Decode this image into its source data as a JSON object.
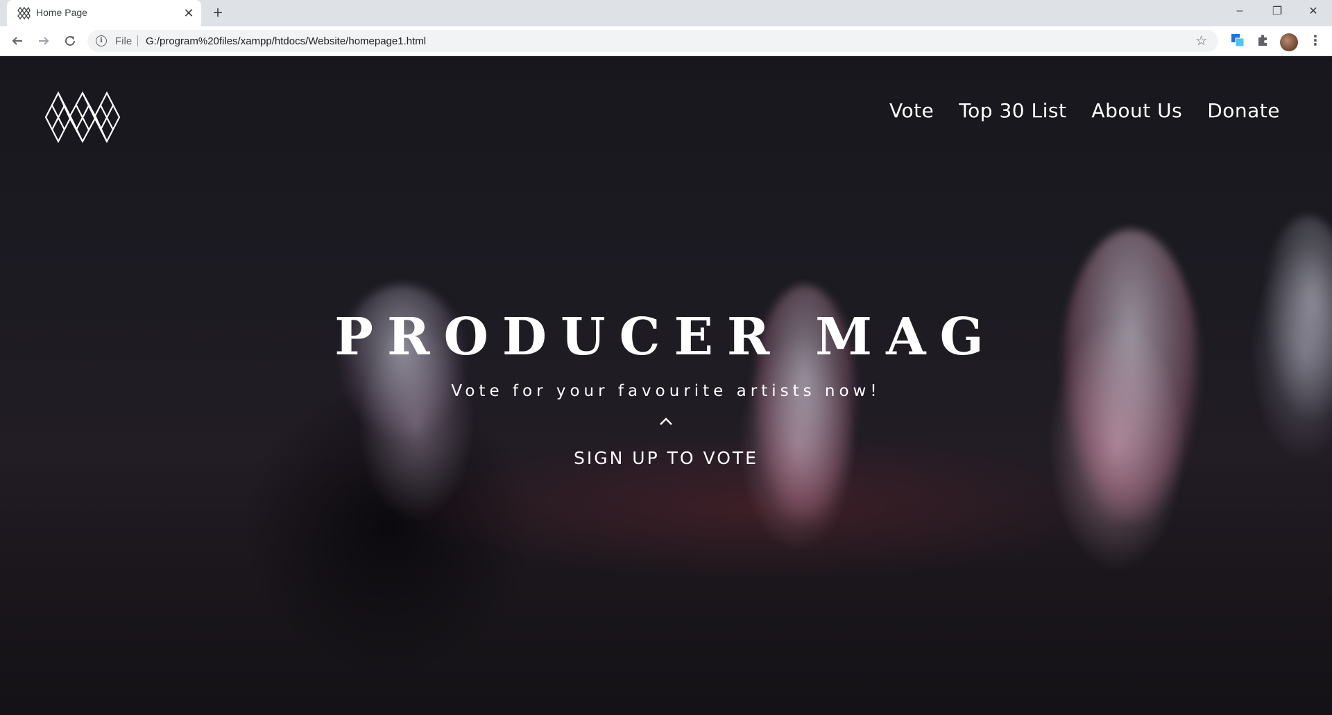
{
  "browser": {
    "tab": {
      "title": "Home Page"
    },
    "omnibox": {
      "scheme_label": "File",
      "url": "G:/program%20files/xampp/htdocs/Website/homepage1.html"
    },
    "window_controls": {
      "minimize": "–",
      "maximize": "❐",
      "close": "✕"
    },
    "icons": [
      "back-icon",
      "forward-icon",
      "reload-icon",
      "info-icon",
      "star-icon",
      "translate-icon",
      "extensions-icon",
      "profile-avatar",
      "menu-icon"
    ]
  },
  "site": {
    "nav": [
      {
        "label": "Vote"
      },
      {
        "label": "Top 30 List"
      },
      {
        "label": "About Us"
      },
      {
        "label": "Donate"
      }
    ],
    "hero": {
      "title": "PRODUCER MAG",
      "subtitle": "Vote for your favourite artists now!",
      "cta": "SIGN UP TO VOTE"
    },
    "colors": {
      "text": "#ffffff",
      "background": "#1c1b22"
    }
  }
}
